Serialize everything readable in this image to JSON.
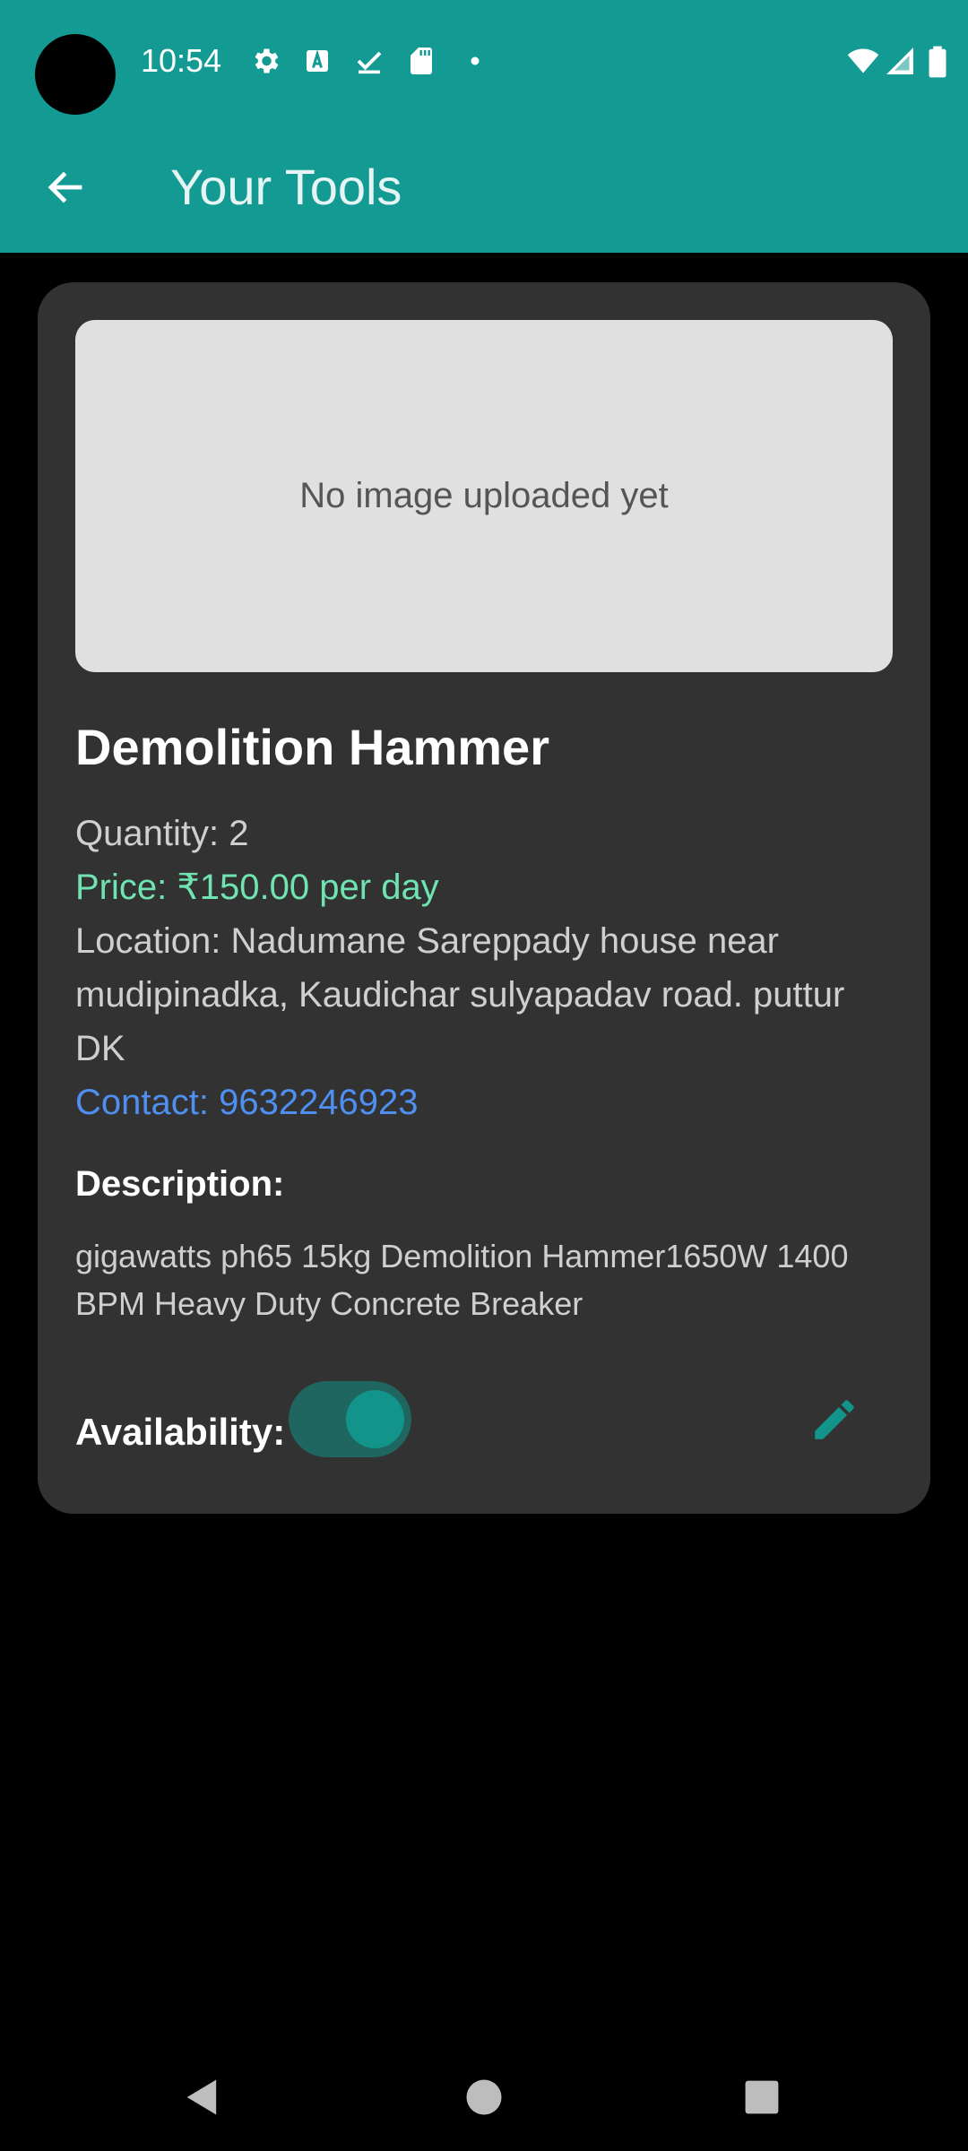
{
  "status_bar": {
    "time": "10:54",
    "icons": [
      "settings-icon",
      "keyboard-a-icon",
      "download-done-icon",
      "sd-card-icon",
      "notification-dot-icon",
      "wifi-icon",
      "cellular-signal-icon",
      "battery-icon"
    ]
  },
  "header": {
    "title": "Your Tools",
    "back_icon": "arrow-back-icon",
    "color": "#139a93"
  },
  "tool": {
    "image_placeholder": "No image uploaded yet",
    "name": "Demolition Hammer",
    "quantity": "Quantity: 2",
    "price": "Price: ₹150.00 per day",
    "location": "Location: Nadumane Sareppady house near mudipinadka, Kaudichar sulyapadav road. puttur DK",
    "contact": "Contact: 9632246923",
    "description_heading": "Description:",
    "description": "gigawatts ph65 15kg Demolition Hammer1650W 1400 BPM Heavy Duty Concrete Breaker",
    "availability_label": "Availability:",
    "availability": true,
    "edit_icon": "pencil-edit-icon"
  },
  "colors": {
    "price": "#6fe3b0",
    "contact": "#4e8ff0",
    "accent": "#12948a",
    "card": "#323232"
  },
  "nav_bar": {
    "buttons": [
      "back-triangle-icon",
      "home-circle-icon",
      "recents-square-icon"
    ]
  }
}
